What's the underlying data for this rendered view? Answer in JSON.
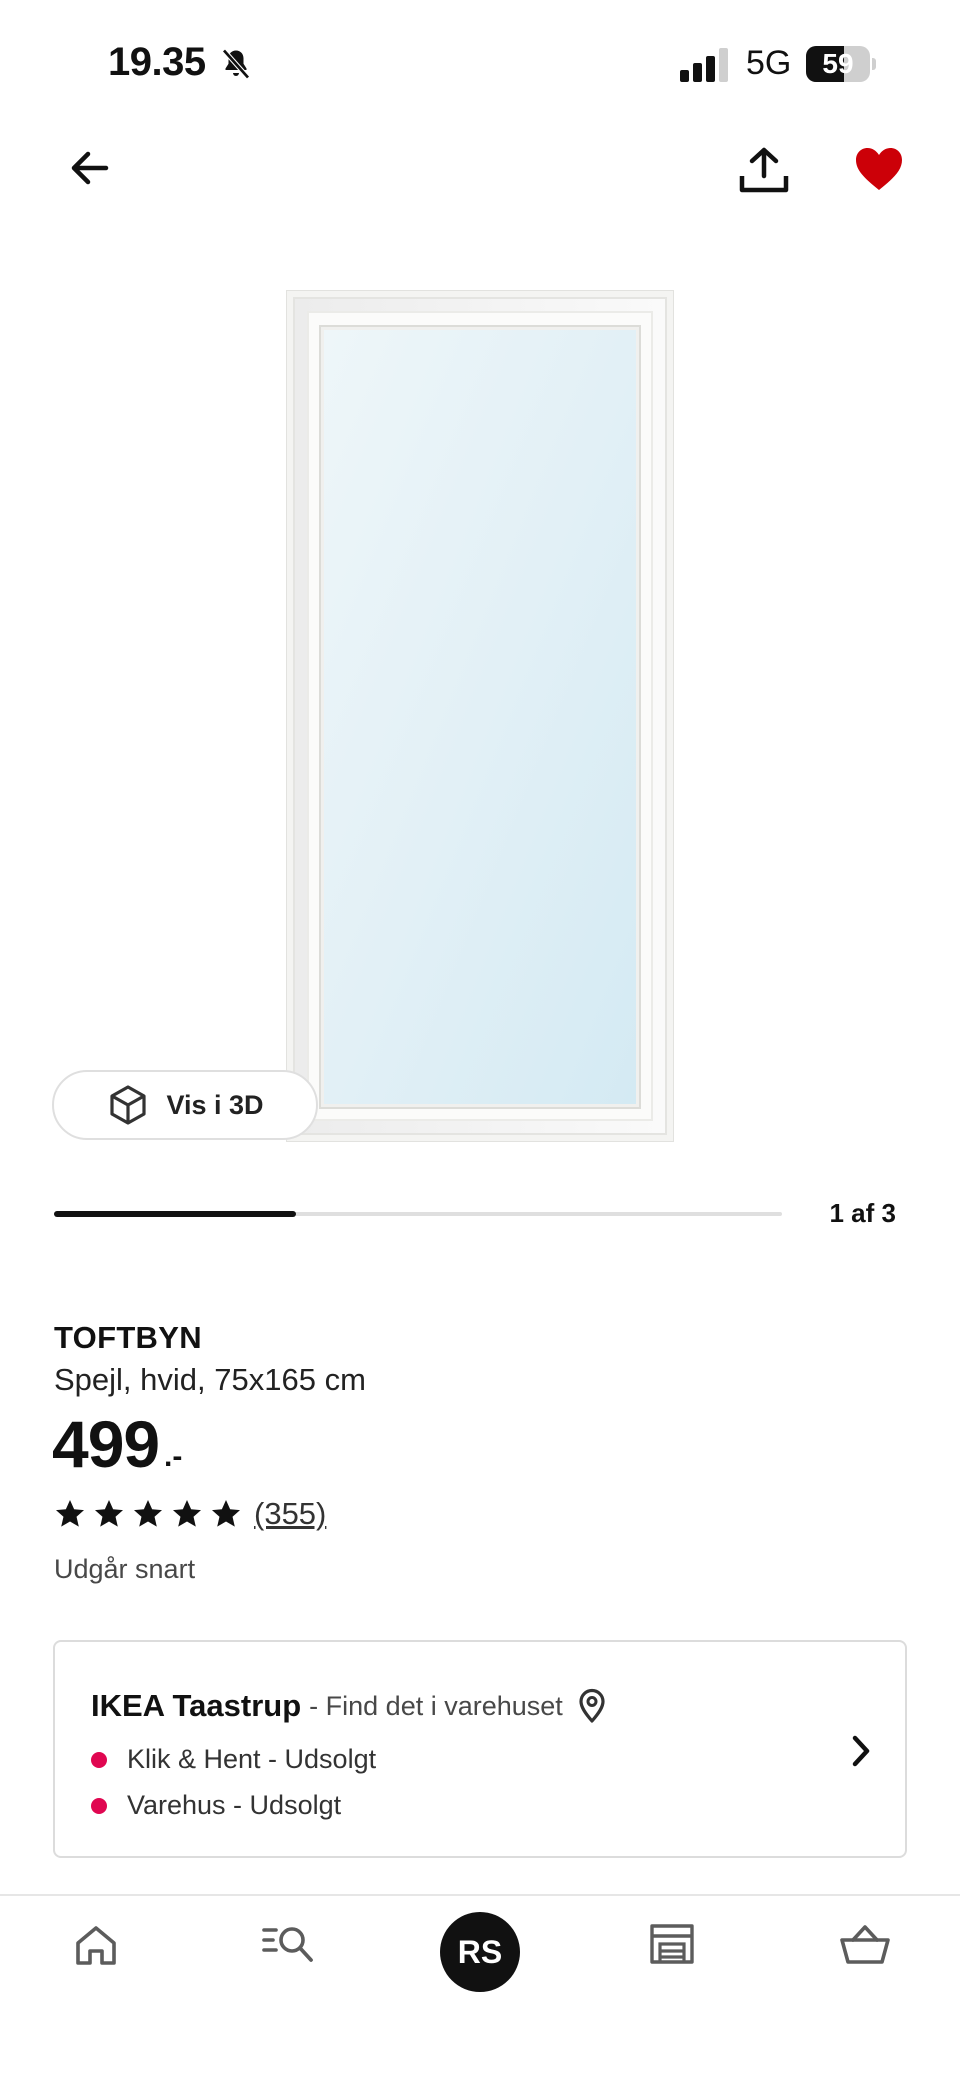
{
  "status_bar": {
    "time": "19.35",
    "network": "5G",
    "battery_level": 59,
    "battery_label": "59"
  },
  "top_bar": {
    "back_icon": "arrow-left-icon",
    "share_icon": "share-icon",
    "favorite_icon": "heart-icon",
    "favorite_color": "#cc0008"
  },
  "gallery": {
    "view_3d_label": "Vis i 3D",
    "counter": "1 af 3",
    "progress": 0.333
  },
  "product": {
    "name": "TOFTBYN",
    "description": "Spejl, hvid, 75x165 cm",
    "price": "499",
    "price_suffix": ".-",
    "rating_stars": 5,
    "reviews": "(355)",
    "note": "Udgår snart"
  },
  "store": {
    "name": "IKEA Taastrup",
    "subtitle": "- Find det i varehuset",
    "availability": [
      {
        "label": "Klik & Hent - Udsolgt",
        "status_color": "#e00751"
      },
      {
        "label": "Varehus - Udsolgt",
        "status_color": "#e00751"
      }
    ]
  },
  "bottom_nav": {
    "items": [
      "home-icon",
      "search-icon",
      "profile",
      "store-icon",
      "basket-icon"
    ],
    "profile_initials": "RS"
  }
}
